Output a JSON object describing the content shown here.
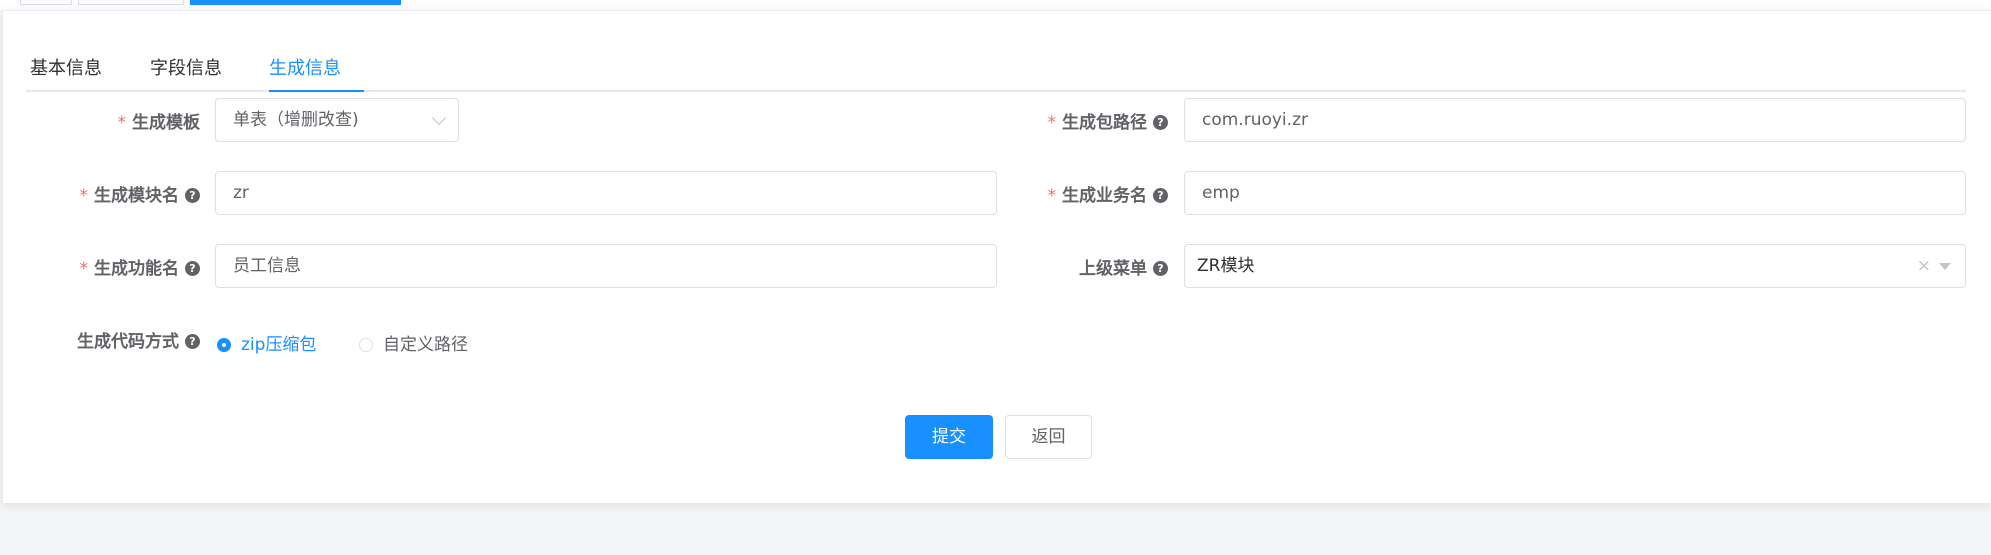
{
  "tabs": [
    {
      "label": "基本信息"
    },
    {
      "label": "字段信息"
    },
    {
      "label": "生成信息"
    }
  ],
  "form": {
    "required_mark": "*",
    "help_glyph": "?",
    "tpl_category": {
      "label": "生成模板",
      "value": "单表（增删改查)"
    },
    "package_name": {
      "label": "生成包路径",
      "value": "com.ruoyi.zr"
    },
    "module_name": {
      "label": "生成模块名",
      "value": "zr"
    },
    "business_name": {
      "label": "生成业务名",
      "value": "emp"
    },
    "function_name": {
      "label": "生成功能名",
      "value": "员工信息"
    },
    "parent_menu": {
      "label": "上级菜单",
      "value": "ZR模块",
      "clear_glyph": "×"
    },
    "gen_type": {
      "label": "生成代码方式",
      "options": [
        {
          "label": "zip压缩包",
          "selected": true
        },
        {
          "label": "自定义路径",
          "selected": false
        }
      ]
    }
  },
  "buttons": {
    "submit": "提交",
    "back": "返回"
  },
  "colors": {
    "primary": "#1890ff",
    "required": "#f56c6c",
    "text": "#606266",
    "border": "#dcdfe6"
  }
}
